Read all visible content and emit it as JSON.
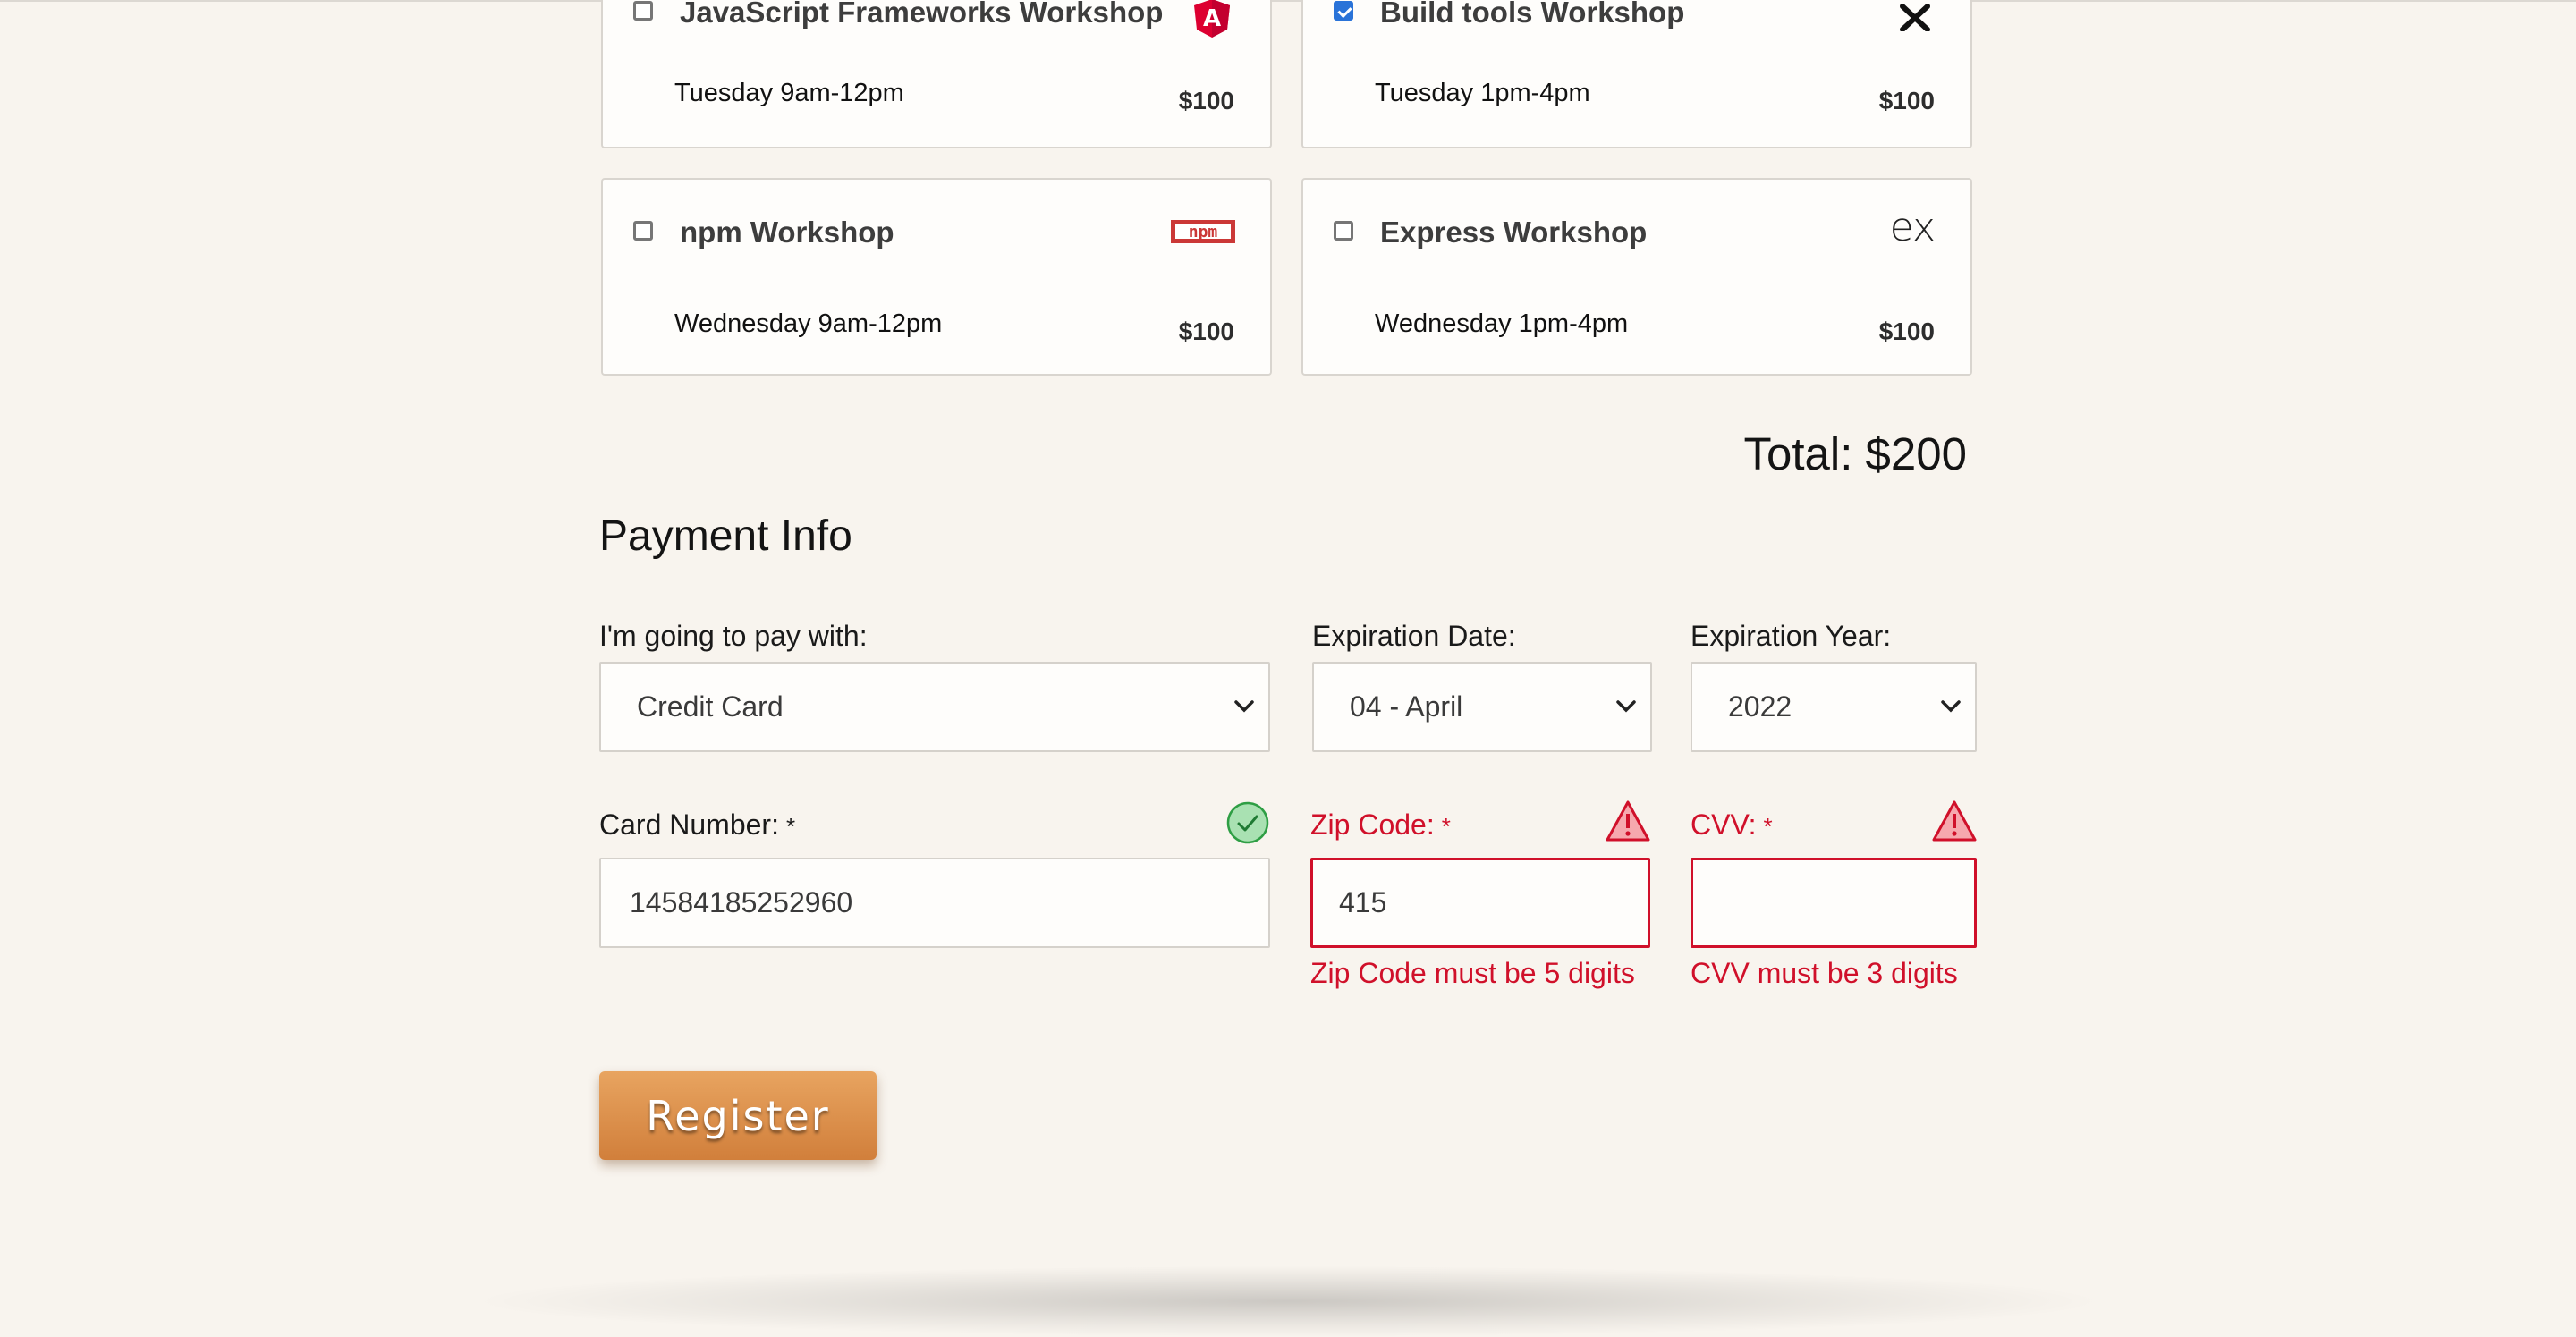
{
  "activities": [
    {
      "name": "JavaScript Frameworks Workshop",
      "time": "Tuesday 9am-12pm",
      "price": "$100",
      "checked": false,
      "logo_icon": "angular-logo-icon"
    },
    {
      "name": "Build tools Workshop",
      "time": "Tuesday 1pm-4pm",
      "price": "$100",
      "checked": true,
      "logo_icon": "close-x-logo-icon"
    },
    {
      "name": "npm Workshop",
      "time": "Wednesday 9am-12pm",
      "price": "$100",
      "checked": false,
      "logo_icon": "npm-logo-icon",
      "logo_text": "npm"
    },
    {
      "name": "Express Workshop",
      "time": "Wednesday 1pm-4pm",
      "price": "$100",
      "checked": false,
      "logo_icon": "express-logo-icon",
      "logo_text": "ex"
    }
  ],
  "total": "Total: $200",
  "payment": {
    "title": "Payment Info",
    "pay_with_label": "I'm going to pay with:",
    "pay_with_value": "Credit Card",
    "exp_date_label": "Expiration Date:",
    "exp_date_value": "04 - April",
    "exp_year_label": "Expiration Year:",
    "exp_year_value": "2022",
    "card_label": "Card Number:",
    "card_value": "14584185252960",
    "zip_label": "Zip Code:",
    "zip_value": "415",
    "zip_error": "Zip Code must be 5 digits",
    "cvv_label": "CVV:",
    "cvv_value": "",
    "cvv_error": "CVV must be 3 digits",
    "required_mark": "*"
  },
  "register_label": "Register",
  "colors": {
    "background": "#f8f4ee",
    "error": "#d0102a",
    "valid": "#2e9e44",
    "button": "#d98c48",
    "angular": "#dd0031",
    "npm": "#cb3837"
  }
}
